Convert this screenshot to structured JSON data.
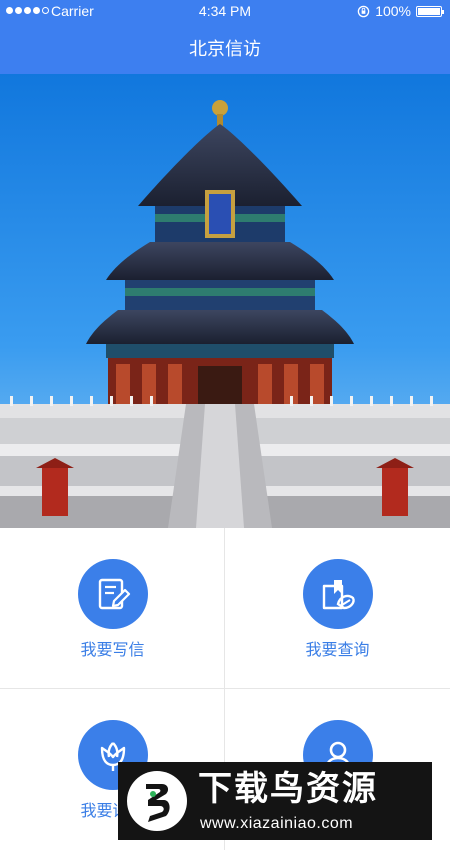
{
  "status_bar": {
    "carrier": "Carrier",
    "time": "4:34 PM",
    "battery": "100%"
  },
  "header": {
    "title": "北京信访",
    "color": "#3d7ff0"
  },
  "hero": {
    "icon": "temple-of-heaven-photo"
  },
  "menu": {
    "accent": "#3b7fe9",
    "items": [
      {
        "label": "我要写信",
        "icon": "write-letter-icon"
      },
      {
        "label": "我要查询",
        "icon": "query-icon"
      },
      {
        "label": "我要评价",
        "icon": "evaluate-icon"
      },
      {
        "label": "",
        "icon": "user-icon"
      }
    ]
  },
  "watermark": {
    "logo_text": "下载鸟资源",
    "url": "www.xiazainiao.com"
  }
}
